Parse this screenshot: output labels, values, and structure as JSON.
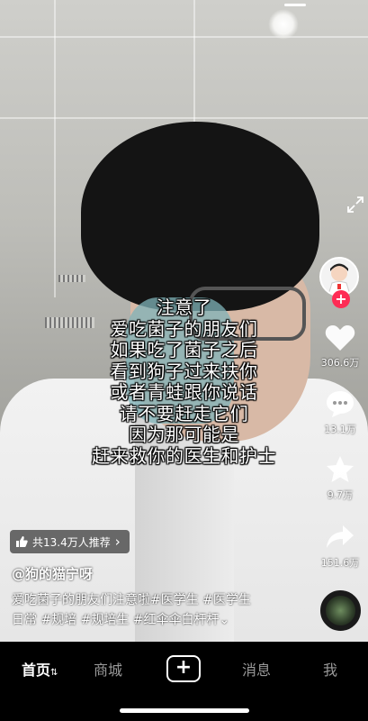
{
  "overlay": {
    "lines": [
      "注意了",
      "爱吃菌子的朋友们",
      "如果吃了菌子之后",
      "看到狗子过来扶你",
      "或者青蛙跟你说话",
      "请不要赶走它们",
      "因为那可能是",
      "赶来救你的医生和护士"
    ]
  },
  "side": {
    "likes": "306.6万",
    "comments": "13.1万",
    "favorites": "9.7万",
    "shares": "151.6万",
    "follow_symbol": "+"
  },
  "recommend": {
    "label": "共13.4万人推荐",
    "chevron": "›"
  },
  "author": "@狗的猫宁呀",
  "description": {
    "line1": "爱吃菌子的朋友们注意啦#医学生 #医学生",
    "line2": "日常 #规培 #规培生 #红伞伞白杆杆⌄"
  },
  "nav": {
    "home": "首页",
    "home_suffix": "⇅",
    "mall": "商城",
    "create": "+",
    "messages": "消息",
    "me": "我"
  },
  "colors": {
    "accent": "#fe2c55",
    "nav_bg": "#000000"
  }
}
